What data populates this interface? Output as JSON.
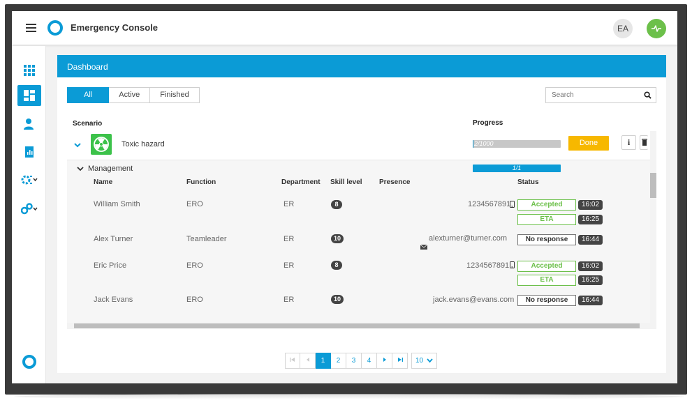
{
  "app": {
    "title": "Emergency Console"
  },
  "header": {
    "user_initials": "EA"
  },
  "panel": {
    "title": "Dashboard"
  },
  "filters": {
    "all": "All",
    "active": "Active",
    "finished": "Finished",
    "selected": "All"
  },
  "search": {
    "placeholder": "Search"
  },
  "columns": {
    "scenario": "Scenario",
    "progress": "Progress"
  },
  "scenario": {
    "name": "Toxic hazard",
    "progress_label": "2/1000",
    "progress": 0.002,
    "action": "Done"
  },
  "group": {
    "name": "Management",
    "progress_label": "1/1",
    "progress": 1.0,
    "headers": {
      "name": "Name",
      "function": "Function",
      "department": "Department",
      "skill": "Skill level",
      "presence": "Presence",
      "status": "Status"
    },
    "members": [
      {
        "name": "William Smith",
        "function": "ERO",
        "department": "ER",
        "skill": "8",
        "presence": "1234567891",
        "presence_type": "phone",
        "statuses": [
          {
            "label": "Accepted",
            "time": "16:02",
            "style": "green"
          },
          {
            "label": "ETA",
            "time": "16:25",
            "style": "green"
          }
        ]
      },
      {
        "name": "Alex Turner",
        "function": "Teamleader",
        "department": "ER",
        "skill": "10",
        "presence": "alexturner@turner.com",
        "presence_type": "email",
        "statuses": [
          {
            "label": "No response",
            "time": "16:44",
            "style": "gray"
          }
        ]
      },
      {
        "name": "Eric Price",
        "function": "ERO",
        "department": "ER",
        "skill": "8",
        "presence": "1234567891",
        "presence_type": "phone",
        "statuses": [
          {
            "label": "Accepted",
            "time": "16:02",
            "style": "green"
          },
          {
            "label": "ETA",
            "time": "16:25",
            "style": "green"
          }
        ]
      },
      {
        "name": "Jack Evans",
        "function": "ERO",
        "department": "ER",
        "skill": "10",
        "presence": "jack.evans@evans.com",
        "presence_type": "email",
        "statuses": [
          {
            "label": "No response",
            "time": "16:44",
            "style": "gray"
          }
        ]
      }
    ]
  },
  "pagination": {
    "pages": [
      "1",
      "2",
      "3",
      "4"
    ],
    "current": "1",
    "page_size": "10"
  },
  "colors": {
    "accent": "#0b9bd6",
    "success": "#6cc04a",
    "warning": "#f7b800",
    "hazard": "#3cc24a"
  }
}
